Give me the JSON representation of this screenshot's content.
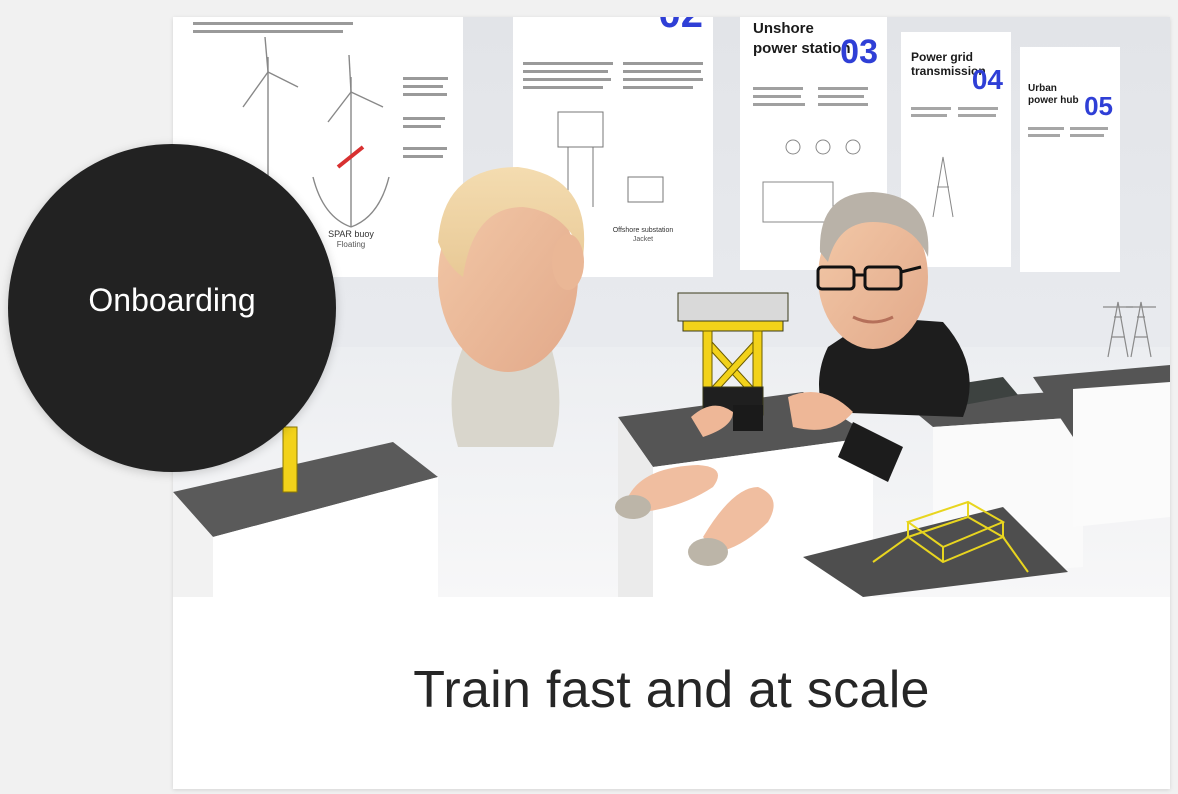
{
  "badge": {
    "label": "Onboarding"
  },
  "caption": {
    "text": "Train fast and at scale"
  },
  "scene": {
    "posters": [
      {
        "title_line1": "Unshore",
        "title_line2": "power station",
        "number": "03"
      },
      {
        "title_line1": "Power grid",
        "title_line2": "transmission",
        "number": "04"
      },
      {
        "title_line1": "Urban",
        "title_line2": "power hub",
        "number": "05"
      },
      {
        "title_line1": "",
        "title_line2": "",
        "number": "02"
      }
    ],
    "poster_labels": {
      "turbine_caption": "SPAR buoy",
      "turbine_subcaption": "Floating",
      "substation_caption": "Offshore substation",
      "substation_subcaption": "Jacket"
    },
    "accent_color": "#2f3fd6",
    "model_yellow": "#f2d21a"
  }
}
